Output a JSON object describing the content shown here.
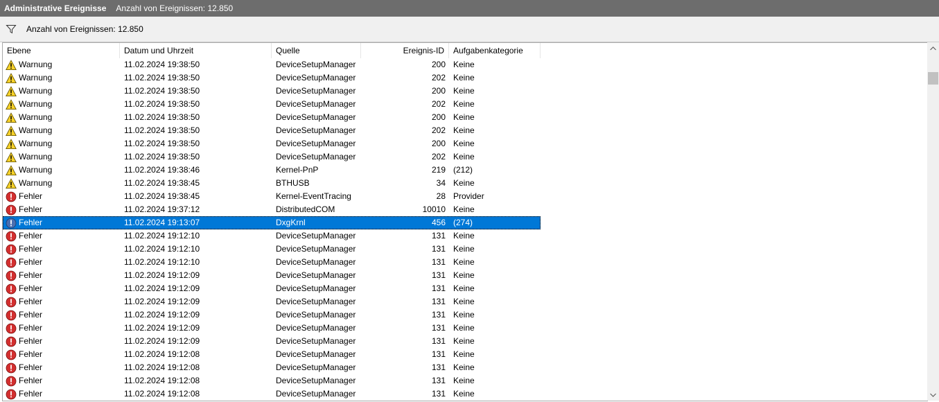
{
  "window": {
    "title": "Administrative Ereignisse",
    "count_label": "Anzahl von Ereignissen: 12.850"
  },
  "filterbar": {
    "icon": "filter-icon",
    "count_label": "Anzahl von Ereignissen: 12.850"
  },
  "table": {
    "columns": [
      "Ebene",
      "Datum und Uhrzeit",
      "Quelle",
      "Ereignis-ID",
      "Aufgabenkategorie"
    ],
    "rows": [
      {
        "level": "Warnung",
        "datetime": "11.02.2024 19:38:50",
        "source": "DeviceSetupManager",
        "event_id": "200",
        "category": "Keine"
      },
      {
        "level": "Warnung",
        "datetime": "11.02.2024 19:38:50",
        "source": "DeviceSetupManager",
        "event_id": "202",
        "category": "Keine"
      },
      {
        "level": "Warnung",
        "datetime": "11.02.2024 19:38:50",
        "source": "DeviceSetupManager",
        "event_id": "200",
        "category": "Keine"
      },
      {
        "level": "Warnung",
        "datetime": "11.02.2024 19:38:50",
        "source": "DeviceSetupManager",
        "event_id": "202",
        "category": "Keine"
      },
      {
        "level": "Warnung",
        "datetime": "11.02.2024 19:38:50",
        "source": "DeviceSetupManager",
        "event_id": "200",
        "category": "Keine"
      },
      {
        "level": "Warnung",
        "datetime": "11.02.2024 19:38:50",
        "source": "DeviceSetupManager",
        "event_id": "202",
        "category": "Keine"
      },
      {
        "level": "Warnung",
        "datetime": "11.02.2024 19:38:50",
        "source": "DeviceSetupManager",
        "event_id": "200",
        "category": "Keine"
      },
      {
        "level": "Warnung",
        "datetime": "11.02.2024 19:38:50",
        "source": "DeviceSetupManager",
        "event_id": "202",
        "category": "Keine"
      },
      {
        "level": "Warnung",
        "datetime": "11.02.2024 19:38:46",
        "source": "Kernel-PnP",
        "event_id": "219",
        "category": "(212)"
      },
      {
        "level": "Warnung",
        "datetime": "11.02.2024 19:38:45",
        "source": "BTHUSB",
        "event_id": "34",
        "category": "Keine"
      },
      {
        "level": "Fehler",
        "datetime": "11.02.2024 19:38:45",
        "source": "Kernel-EventTracing",
        "event_id": "28",
        "category": "Provider"
      },
      {
        "level": "Fehler",
        "datetime": "11.02.2024 19:37:12",
        "source": "DistributedCOM",
        "event_id": "10010",
        "category": "Keine"
      },
      {
        "level": "Fehler",
        "datetime": "11.02.2024 19:13:07",
        "source": "DxgKrnl",
        "event_id": "456",
        "category": "(274)",
        "selected": true
      },
      {
        "level": "Fehler",
        "datetime": "11.02.2024 19:12:10",
        "source": "DeviceSetupManager",
        "event_id": "131",
        "category": "Keine"
      },
      {
        "level": "Fehler",
        "datetime": "11.02.2024 19:12:10",
        "source": "DeviceSetupManager",
        "event_id": "131",
        "category": "Keine"
      },
      {
        "level": "Fehler",
        "datetime": "11.02.2024 19:12:10",
        "source": "DeviceSetupManager",
        "event_id": "131",
        "category": "Keine"
      },
      {
        "level": "Fehler",
        "datetime": "11.02.2024 19:12:09",
        "source": "DeviceSetupManager",
        "event_id": "131",
        "category": "Keine"
      },
      {
        "level": "Fehler",
        "datetime": "11.02.2024 19:12:09",
        "source": "DeviceSetupManager",
        "event_id": "131",
        "category": "Keine"
      },
      {
        "level": "Fehler",
        "datetime": "11.02.2024 19:12:09",
        "source": "DeviceSetupManager",
        "event_id": "131",
        "category": "Keine"
      },
      {
        "level": "Fehler",
        "datetime": "11.02.2024 19:12:09",
        "source": "DeviceSetupManager",
        "event_id": "131",
        "category": "Keine"
      },
      {
        "level": "Fehler",
        "datetime": "11.02.2024 19:12:09",
        "source": "DeviceSetupManager",
        "event_id": "131",
        "category": "Keine"
      },
      {
        "level": "Fehler",
        "datetime": "11.02.2024 19:12:09",
        "source": "DeviceSetupManager",
        "event_id": "131",
        "category": "Keine"
      },
      {
        "level": "Fehler",
        "datetime": "11.02.2024 19:12:08",
        "source": "DeviceSetupManager",
        "event_id": "131",
        "category": "Keine"
      },
      {
        "level": "Fehler",
        "datetime": "11.02.2024 19:12:08",
        "source": "DeviceSetupManager",
        "event_id": "131",
        "category": "Keine"
      },
      {
        "level": "Fehler",
        "datetime": "11.02.2024 19:12:08",
        "source": "DeviceSetupManager",
        "event_id": "131",
        "category": "Keine"
      },
      {
        "level": "Fehler",
        "datetime": "11.02.2024 19:12:08",
        "source": "DeviceSetupManager",
        "event_id": "131",
        "category": "Keine"
      }
    ]
  },
  "icons": {
    "Warnung": "warning-icon",
    "Fehler": "error-icon"
  },
  "colors": {
    "title_bar": "#6d6d6d",
    "selection": "#0078d7",
    "warning": "#f8d22a",
    "error": "#d32f2f"
  }
}
